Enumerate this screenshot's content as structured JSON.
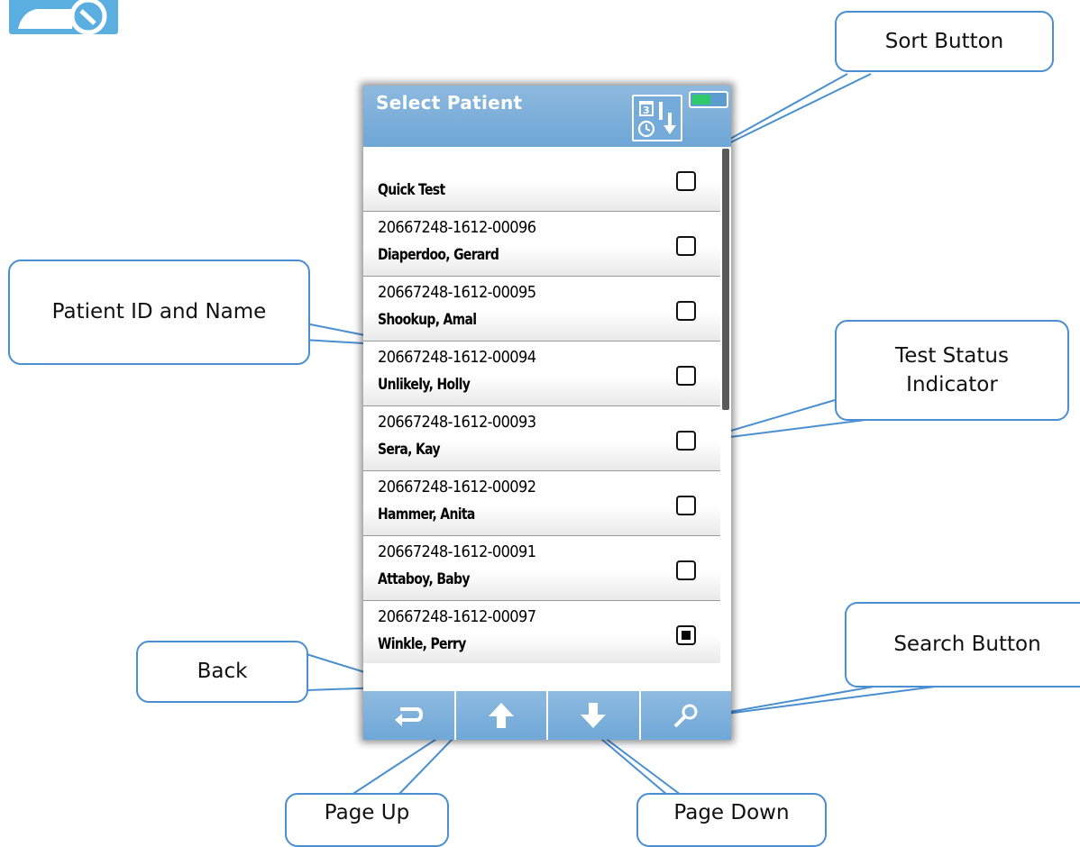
{
  "device": {
    "title": "Select Patient",
    "patients": [
      {
        "id": "",
        "name": "Quick Test",
        "tested": false
      },
      {
        "id": "20667248-1612-00096",
        "name": "Diaperdoo, Gerard",
        "tested": false
      },
      {
        "id": "20667248-1612-00095",
        "name": "Shookup, Amal",
        "tested": false
      },
      {
        "id": "20667248-1612-00094",
        "name": "Unlikely, Holly",
        "tested": false
      },
      {
        "id": "20667248-1612-00093",
        "name": "Sera, Kay",
        "tested": false
      },
      {
        "id": "20667248-1612-00092",
        "name": "Hammer, Anita",
        "tested": false
      },
      {
        "id": "20667248-1612-00091",
        "name": "Attaboy, Baby",
        "tested": false
      },
      {
        "id": "20667248-1612-00097",
        "name": "Winkle, Perry",
        "tested": true
      }
    ],
    "toolbar": [
      "back-icon",
      "arrow-up-icon",
      "arrow-down-icon",
      "search-icon"
    ],
    "sort_icon": "sort-by-date-time-icon",
    "battery_icon": "battery-icon"
  },
  "callouts": {
    "sort": "Sort Button",
    "patient": "Patient ID and Name",
    "status": "Test Status Indicator",
    "search": "Search Button",
    "back": "Back",
    "page_up": "Page Up",
    "page_down": "Page Down"
  },
  "colors": {
    "header_blue": "#7ab0dc",
    "callout_border": "#4a8fd1",
    "battery_green": "#2fc86b"
  }
}
